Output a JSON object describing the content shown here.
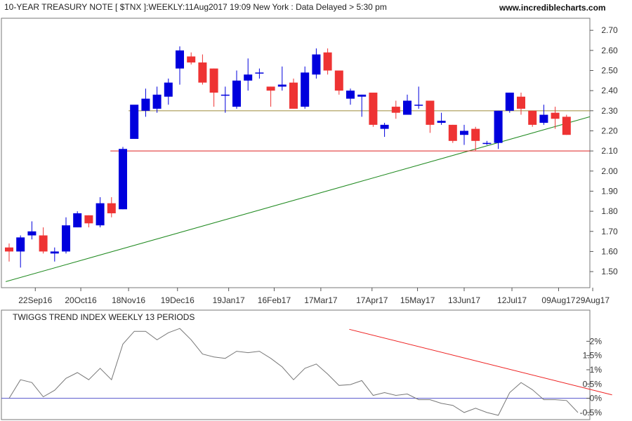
{
  "header": {
    "title": "10-YEAR TREASURY NOTE [ $TNX ]:WEEKLY:11Aug2017 19:09 New York : Data Delayed > 5:30 pm",
    "site": "www.incrediblecharts.com"
  },
  "colors": {
    "up": "#0000dd",
    "down": "#ee3333",
    "trendline": "#228b22",
    "resistance": "#9c8a3a",
    "support": "#dd2222",
    "indicator_line": "#777777",
    "indicator_trend": "#ee2222",
    "zero_line": "#5555cc"
  },
  "chart_data": [
    {
      "type": "candlestick",
      "title": "10-YEAR TREASURY NOTE [ $TNX ]:WEEKLY:11Aug2017 19:09 New York : Data Delayed > 5:30 pm",
      "ylim": [
        1.42,
        2.76
      ],
      "y_ticks": [
        "2.70",
        "2.60",
        "2.50",
        "2.40",
        "2.30",
        "2.20",
        "2.10",
        "2.00",
        "1.90",
        "1.80",
        "1.70",
        "1.60",
        "1.50"
      ],
      "x_ticks": [
        {
          "label": "22Sep16",
          "index": 2.3
        },
        {
          "label": "20Oct16",
          "index": 6.3
        },
        {
          "label": "18Nov16",
          "index": 10.5
        },
        {
          "label": "19Dec16",
          "index": 14.8
        },
        {
          "label": "19Jan17",
          "index": 19.3
        },
        {
          "label": "16Feb17",
          "index": 23.3
        },
        {
          "label": "17Mar17",
          "index": 27.4
        },
        {
          "label": "17Apr17",
          "index": 31.9
        },
        {
          "label": "15May17",
          "index": 35.9
        },
        {
          "label": "13Jun17",
          "index": 40.0
        },
        {
          "label": "12Jul17",
          "index": 44.2
        },
        {
          "label": "09Aug17",
          "index": 48.3
        },
        {
          "label": "29Aug17",
          "index": 51.3
        }
      ],
      "candles": [
        {
          "o": 1.62,
          "h": 1.64,
          "l": 1.55,
          "c": 1.6
        },
        {
          "o": 1.6,
          "h": 1.68,
          "l": 1.52,
          "c": 1.67
        },
        {
          "o": 1.68,
          "h": 1.75,
          "l": 1.66,
          "c": 1.7
        },
        {
          "o": 1.68,
          "h": 1.72,
          "l": 1.59,
          "c": 1.6
        },
        {
          "o": 1.59,
          "h": 1.62,
          "l": 1.55,
          "c": 1.6
        },
        {
          "o": 1.6,
          "h": 1.77,
          "l": 1.59,
          "c": 1.73
        },
        {
          "o": 1.72,
          "h": 1.8,
          "l": 1.72,
          "c": 1.79
        },
        {
          "o": 1.78,
          "h": 1.78,
          "l": 1.72,
          "c": 1.74
        },
        {
          "o": 1.73,
          "h": 1.87,
          "l": 1.72,
          "c": 1.84
        },
        {
          "o": 1.84,
          "h": 1.87,
          "l": 1.77,
          "c": 1.79
        },
        {
          "o": 1.81,
          "h": 2.12,
          "l": 1.81,
          "c": 2.11
        },
        {
          "o": 2.16,
          "h": 2.32,
          "l": 2.18,
          "c": 2.33
        },
        {
          "o": 2.3,
          "h": 2.41,
          "l": 2.27,
          "c": 2.36
        },
        {
          "o": 2.31,
          "h": 2.42,
          "l": 2.29,
          "c": 2.38
        },
        {
          "o": 2.37,
          "h": 2.46,
          "l": 2.33,
          "c": 2.44
        },
        {
          "o": 2.51,
          "h": 2.62,
          "l": 2.43,
          "c": 2.6
        },
        {
          "o": 2.57,
          "h": 2.59,
          "l": 2.53,
          "c": 2.54
        },
        {
          "o": 2.54,
          "h": 2.58,
          "l": 2.43,
          "c": 2.44
        },
        {
          "o": 2.51,
          "h": 2.51,
          "l": 2.32,
          "c": 2.39
        },
        {
          "o": 2.38,
          "h": 2.42,
          "l": 2.29,
          "c": 2.38
        },
        {
          "o": 2.32,
          "h": 2.5,
          "l": 2.31,
          "c": 2.45
        },
        {
          "o": 2.45,
          "h": 2.56,
          "l": 2.4,
          "c": 2.48
        },
        {
          "o": 2.49,
          "h": 2.51,
          "l": 2.46,
          "c": 2.49
        },
        {
          "o": 2.42,
          "h": 2.42,
          "l": 2.32,
          "c": 2.4
        },
        {
          "o": 2.42,
          "h": 2.52,
          "l": 2.4,
          "c": 2.43
        },
        {
          "o": 2.44,
          "h": 2.46,
          "l": 2.31,
          "c": 2.31
        },
        {
          "o": 2.32,
          "h": 2.52,
          "l": 2.31,
          "c": 2.49
        },
        {
          "o": 2.48,
          "h": 2.61,
          "l": 2.46,
          "c": 2.58
        },
        {
          "o": 2.59,
          "h": 2.61,
          "l": 2.48,
          "c": 2.5
        },
        {
          "o": 2.5,
          "h": 2.5,
          "l": 2.38,
          "c": 2.4
        },
        {
          "o": 2.36,
          "h": 2.41,
          "l": 2.33,
          "c": 2.4
        },
        {
          "o": 2.37,
          "h": 2.38,
          "l": 2.27,
          "c": 2.38
        },
        {
          "o": 2.39,
          "h": 2.39,
          "l": 2.22,
          "c": 2.23
        },
        {
          "o": 2.21,
          "h": 2.24,
          "l": 2.17,
          "c": 2.23
        },
        {
          "o": 2.32,
          "h": 2.35,
          "l": 2.26,
          "c": 2.29
        },
        {
          "o": 2.28,
          "h": 2.38,
          "l": 2.28,
          "c": 2.35
        },
        {
          "o": 2.33,
          "h": 2.42,
          "l": 2.31,
          "c": 2.33
        },
        {
          "o": 2.35,
          "h": 2.35,
          "l": 2.19,
          "c": 2.23
        },
        {
          "o": 2.24,
          "h": 2.29,
          "l": 2.23,
          "c": 2.25
        },
        {
          "o": 2.23,
          "h": 2.23,
          "l": 2.14,
          "c": 2.15
        },
        {
          "o": 2.18,
          "h": 2.23,
          "l": 2.13,
          "c": 2.2
        },
        {
          "o": 2.21,
          "h": 2.22,
          "l": 2.1,
          "c": 2.15
        },
        {
          "o": 2.14,
          "h": 2.15,
          "l": 2.13,
          "c": 2.14
        },
        {
          "o": 2.14,
          "h": 2.3,
          "l": 2.11,
          "c": 2.3
        },
        {
          "o": 2.3,
          "h": 2.39,
          "l": 2.29,
          "c": 2.39
        },
        {
          "o": 2.37,
          "h": 2.39,
          "l": 2.28,
          "c": 2.31
        },
        {
          "o": 2.3,
          "h": 2.3,
          "l": 2.22,
          "c": 2.23
        },
        {
          "o": 2.24,
          "h": 2.33,
          "l": 2.23,
          "c": 2.28
        },
        {
          "o": 2.29,
          "h": 2.32,
          "l": 2.21,
          "c": 2.26
        },
        {
          "o": 2.27,
          "h": 2.28,
          "l": 2.18,
          "c": 2.18
        }
      ],
      "lines": [
        {
          "name": "rising-trendline",
          "x1": -0.3,
          "y1": 1.45,
          "x2": 54,
          "y2": 2.27,
          "color": "#228b22"
        },
        {
          "name": "resistance-line",
          "x1": 10.5,
          "y1": 2.3,
          "x2": 54,
          "y2": 2.3,
          "color": "#9c8a3a"
        },
        {
          "name": "support-line",
          "x1": 8.9,
          "y1": 2.1,
          "x2": 54,
          "y2": 2.1,
          "color": "#dd2222"
        }
      ]
    },
    {
      "type": "line",
      "title": "TWIGGS TREND INDEX WEEKLY 13 PERIODS",
      "ylim": [
        -0.7,
        2.6
      ],
      "y_ticks": [
        "2%",
        "1.5%",
        "1%",
        "0.5%",
        "0%",
        "-0.5%"
      ],
      "y_tick_values": [
        2,
        1.5,
        1,
        0.5,
        0,
        -0.5
      ],
      "values": [
        0.0,
        0.65,
        0.55,
        0.05,
        0.28,
        0.7,
        0.9,
        0.65,
        1.05,
        0.65,
        1.9,
        2.35,
        2.35,
        2.05,
        2.3,
        2.45,
        2.05,
        1.55,
        1.45,
        1.4,
        1.65,
        1.6,
        1.65,
        1.4,
        1.1,
        0.65,
        1.05,
        1.2,
        0.85,
        0.45,
        0.48,
        0.62,
        0.1,
        0.2,
        0.1,
        0.15,
        -0.05,
        -0.05,
        -0.18,
        -0.25,
        -0.5,
        -0.35,
        -0.5,
        -0.6,
        0.2,
        0.55,
        0.3,
        -0.05,
        -0.05,
        -0.08,
        -0.5
      ],
      "zero_line": 0,
      "trendline": {
        "x1": 29.9,
        "y1": 2.42,
        "x2": 53,
        "y2": 0.12
      }
    }
  ]
}
